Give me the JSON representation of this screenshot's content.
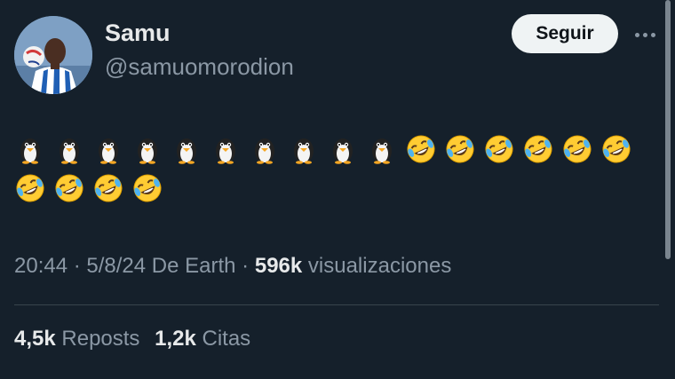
{
  "author": {
    "display_name": "Samu",
    "handle": "@samuomorodion"
  },
  "follow_button_label": "Seguir",
  "tweet": {
    "emoji_rows": [
      [
        "penguin",
        "penguin",
        "penguin",
        "penguin",
        "penguin",
        "penguin",
        "penguin",
        "penguin",
        "penguin",
        "penguin",
        "rolling-on-floor-laughing",
        "rolling-on-floor-laughing",
        "rolling-on-floor-laughing",
        "rolling-on-floor-laughing",
        "rolling-on-floor-laughing",
        "rolling-on-floor-laughing"
      ],
      [
        "rolling-on-floor-laughing",
        "rolling-on-floor-laughing",
        "rolling-on-floor-laughing",
        "rolling-on-floor-laughing"
      ]
    ]
  },
  "meta": {
    "time": "20:44",
    "sep1": " · ",
    "date": "5/8/24",
    "source": " De Earth",
    "sep2": " · ",
    "views_count": "596k",
    "views_label": " visualizaciones"
  },
  "stats": {
    "reposts_count": "4,5k",
    "reposts_label": " Reposts",
    "quotes_count": "1,2k",
    "quotes_label": " Citas"
  },
  "colors": {
    "background": "#15202b",
    "primary_text": "#e7e9ea",
    "secondary_text": "#8b98a5",
    "divider": "#38444d",
    "follow_button_bg": "#eff3f4"
  }
}
